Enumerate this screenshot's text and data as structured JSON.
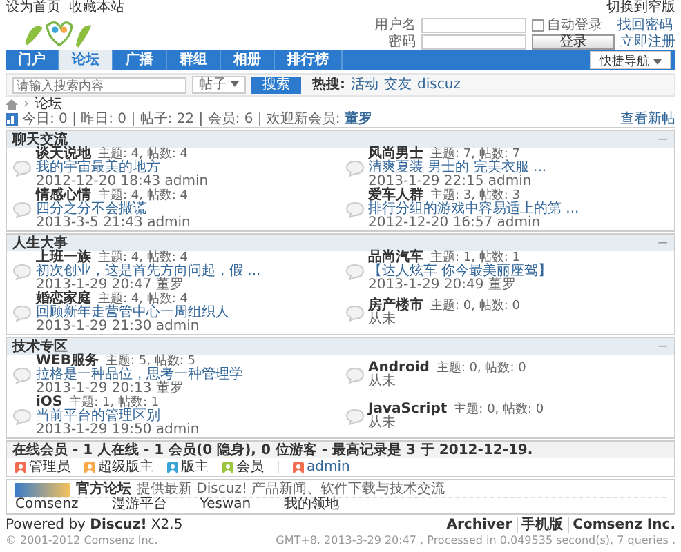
{
  "topbar": {
    "links": [
      "设为首页",
      "收藏本站"
    ],
    "switch": "切换到窄版"
  },
  "login": {
    "username_label": "用户名",
    "remember": {
      "label": "自动登录",
      "checked": false
    },
    "forgot": "找回密码",
    "password_label": "密码",
    "button": "登录",
    "register": "立即注册"
  },
  "nav": {
    "items": [
      {
        "label": "门户",
        "selected": false
      },
      {
        "label": "论坛",
        "selected": true
      },
      {
        "label": "广播",
        "selected": false
      },
      {
        "label": "群组",
        "selected": false
      },
      {
        "label": "相册",
        "selected": false
      },
      {
        "label": "排行榜",
        "selected": false
      }
    ],
    "quick_nav": "快捷导航"
  },
  "search": {
    "placeholder": "请输入搜索内容",
    "scope": "帖子",
    "button": "搜索",
    "hot_label": "热搜:",
    "hot": [
      "活动",
      "交友",
      "discuz"
    ]
  },
  "breadcrumb": {
    "separator": "›",
    "items": [
      "论坛"
    ]
  },
  "stats": {
    "text": "今日: 0 | 昨日: 0 | 帖子: 22 | 会员: 6 | 欢迎新会员:",
    "newest": "董罗",
    "new_posts": "查看新帖"
  },
  "sections": [
    {
      "title": "聊天交流",
      "toggle": "−",
      "forums": [
        {
          "name": "谈天说地",
          "stats": "主题: 4, 帖数: 4",
          "last": "我的宇宙最美的地方",
          "meta": "2012-12-20 18:43 admin"
        },
        {
          "name": "风尚男士",
          "stats": "主题: 7, 帖数: 7",
          "last": "清爽夏装 男士的 完美衣服 ...",
          "meta": "2013-1-29 22:15 admin"
        },
        {
          "name": "情感心情",
          "stats": "主题: 4, 帖数: 4",
          "last": "四分之分不会撒谎",
          "meta": "2013-3-5 21:43 admin"
        },
        {
          "name": "爱车人群",
          "stats": "主题: 3, 帖数: 3",
          "last": "排行分组的游戏中容易适上的第 ...",
          "meta": "2012-12-20 16:57 admin"
        }
      ]
    },
    {
      "title": "人生大事",
      "toggle": "−",
      "forums": [
        {
          "name": "上班一族",
          "stats": "主题: 4, 帖数: 4",
          "last": "初次创业，这是首先方向问起，假 ...",
          "meta": "2013-1-29 20:47 董罗"
        },
        {
          "name": "品尚汽车",
          "stats": "主题: 1, 帖数: 1",
          "last": "【达人炫车 你今最美丽座驾】",
          "meta": "2013-1-29 20:49 董罗"
        },
        {
          "name": "婚恋家庭",
          "stats": "主题: 4, 帖数: 4",
          "last": "回顾新年走营管中心一周组织人",
          "meta": "2013-1-29 21:30 admin"
        },
        {
          "name": "房产楼市",
          "stats": "主题: 0, 帖数: 0",
          "meta": "从未"
        }
      ]
    },
    {
      "title": "技术专区",
      "toggle": "−",
      "forums": [
        {
          "name": "WEB服务",
          "stats": "主题: 5, 帖数: 5",
          "last": "拉格是一种品位，思考一种管理学",
          "meta": "2013-1-29 20:13 董罗"
        },
        {
          "name": "Android",
          "stats": "主题: 0, 帖数: 0",
          "meta": "从未"
        },
        {
          "name": "iOS",
          "stats": "主题: 1, 帖数: 1",
          "last": "当前平台的管理区别",
          "meta": "2013-1-29 19:50 admin"
        },
        {
          "name": "JavaScript",
          "stats": "主题: 0, 帖数: 0",
          "meta": "从未"
        }
      ]
    }
  ],
  "online": {
    "title": "在线会员 - 1 人在线 - 1 会员(0 隐身), 0 位游客 - 最高记录是 3 于 2012-12-19.",
    "legend": [
      {
        "label": "管理员",
        "color": "#f26c4f"
      },
      {
        "label": "超级版主",
        "color": "#f7a84b"
      },
      {
        "label": "版主",
        "color": "#3aa4d9"
      },
      {
        "label": "会员",
        "color": "#9bc53d"
      }
    ],
    "users": [
      {
        "name": "admin",
        "color": "#f26c4f"
      }
    ]
  },
  "links": {
    "featured": {
      "title": "官方论坛",
      "text": "提供最新 Discuz! 产品新闻、软件下载与技术交流"
    },
    "items": [
      "Comsenz",
      "漫游平台",
      "Yeswan",
      "我的领地"
    ]
  },
  "footer": {
    "powered": "Powered by **Discuz!** X2.5",
    "copyright": "© 2001-2012 Comsenz Inc.",
    "links": [
      "Archiver",
      "手机版",
      "Comsenz Inc."
    ],
    "stats": "GMT+8, 2013-3-29 20:47 , Processed in 0.049535 second(s), 7 queries ."
  }
}
